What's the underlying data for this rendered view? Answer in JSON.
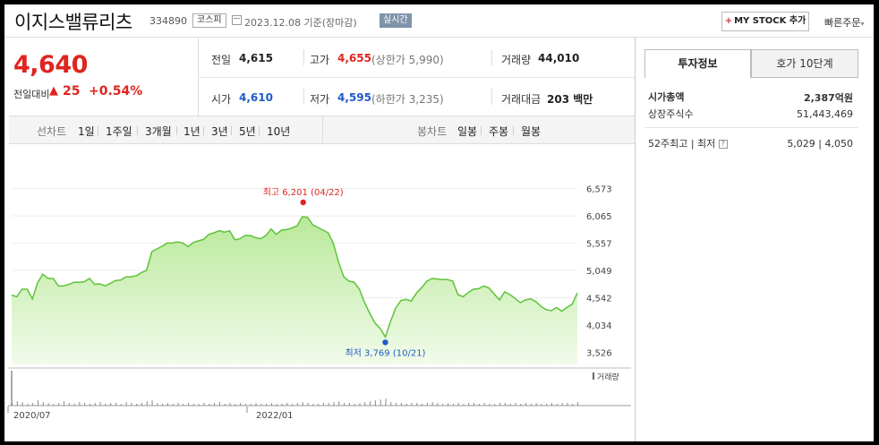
{
  "header": {
    "name": "이지스밸류리츠",
    "code": "334890",
    "market": "코스피",
    "date": "2023.12.08",
    "date_basis": "기준(장마감)",
    "live": "실시간",
    "mystock_label": "MY STOCK 추가",
    "quick_order": "빠른주문"
  },
  "price": {
    "current": "4,640",
    "prev_label": "전일대비",
    "change": "25",
    "change_pct": "+0.54%"
  },
  "stats": {
    "prev_close_label": "전일",
    "prev_close": "4,615",
    "high_label": "고가",
    "high": "4,655",
    "upper_limit": "(상한가 5,990)",
    "volume_label": "거래량",
    "volume": "44,010",
    "open_label": "시가",
    "open": "4,610",
    "low_label": "저가",
    "low": "4,595",
    "lower_limit": "(하한가 3,235)",
    "amount_label": "거래대금",
    "amount": "203 백만"
  },
  "period_bar": {
    "line_label": "선차트",
    "periods": [
      "1일",
      "1주일",
      "3개월",
      "1년",
      "3년",
      "5년",
      "10년"
    ],
    "selected": "10년",
    "candle_label": "봉차트",
    "candles": [
      "일봉",
      "주봉",
      "월봉"
    ]
  },
  "right_panel": {
    "tab_invest": "투자정보",
    "tab_orderbook": "호가 10단계",
    "market_cap_label": "시가총액",
    "market_cap": "2,387억원",
    "shares_label": "상장주식수",
    "shares": "51,443,469",
    "range_label": "52주최고 | 최저",
    "help_icon": "?",
    "range_value": "5,029 | 4,050"
  },
  "colors": {
    "up": "#e0241f",
    "down": "#1f5cc8",
    "line": "#5fc33a",
    "fill_top": "#b9e99a",
    "fill_bottom": "#f1fbea"
  },
  "chart_data": {
    "type": "area",
    "period": "10년",
    "ylim": [
      3400,
      6700
    ],
    "y_ticks": [
      "6,573",
      "6,065",
      "5,557",
      "5,049",
      "4,542",
      "4,034",
      "3,526"
    ],
    "x_labels": [
      "2020/07",
      "2022/01"
    ],
    "max_annotation": "최고 6,201 (04/22)",
    "min_annotation": "최저 3,769 (10/21)",
    "volume_label": "거래량",
    "series": [
      {
        "values": [
          4590,
          4560,
          4700,
          4700,
          4520,
          4820,
          4980,
          4900,
          4900,
          4760,
          4760,
          4790,
          4830,
          4830,
          4840,
          4900,
          4790,
          4800,
          4760,
          4810,
          4860,
          4870,
          4930,
          4930,
          4950,
          5010,
          5050,
          5400,
          5450,
          5500,
          5560,
          5560,
          5580,
          5560,
          5490,
          5570,
          5600,
          5630,
          5720,
          5750,
          5790,
          5760,
          5790,
          5620,
          5640,
          5700,
          5700,
          5660,
          5640,
          5700,
          5820,
          5720,
          5800,
          5810,
          5840,
          5880,
          6050,
          6040,
          5900,
          5850,
          5800,
          5750,
          5550,
          5200,
          4930,
          4850,
          4830,
          4700,
          4450,
          4250,
          4070,
          3970,
          3810,
          4100,
          4350,
          4490,
          4510,
          4480,
          4630,
          4730,
          4850,
          4900,
          4890,
          4880,
          4880,
          4850,
          4600,
          4560,
          4640,
          4700,
          4710,
          4760,
          4720,
          4610,
          4500,
          4650,
          4600,
          4530,
          4450,
          4500,
          4520,
          4470,
          4380,
          4320,
          4300,
          4360,
          4290,
          4360,
          4420,
          4630
        ]
      }
    ],
    "volume": [
      3,
      5,
      4,
      2,
      3,
      6,
      4,
      3,
      2,
      3,
      5,
      3,
      2,
      4,
      3,
      2,
      3,
      4,
      2,
      3,
      3,
      2,
      4,
      3,
      2,
      3,
      5,
      6,
      3,
      2,
      3,
      2,
      3,
      2,
      3,
      2,
      2,
      3,
      2,
      3,
      4,
      2,
      3,
      2,
      3,
      2,
      2,
      3,
      2,
      2,
      3,
      2,
      2,
      3,
      2,
      3,
      4,
      3,
      2,
      2,
      3,
      3,
      4,
      5,
      3,
      3,
      2,
      3,
      4,
      5,
      6,
      7,
      8,
      4,
      3,
      3,
      2,
      3,
      3,
      2,
      3,
      4,
      3,
      2,
      3,
      2,
      3,
      2,
      3,
      3,
      2,
      3,
      2,
      2,
      3,
      3,
      2,
      3,
      2,
      3,
      2,
      3,
      2,
      2,
      3,
      2,
      3,
      3,
      2,
      4
    ]
  }
}
